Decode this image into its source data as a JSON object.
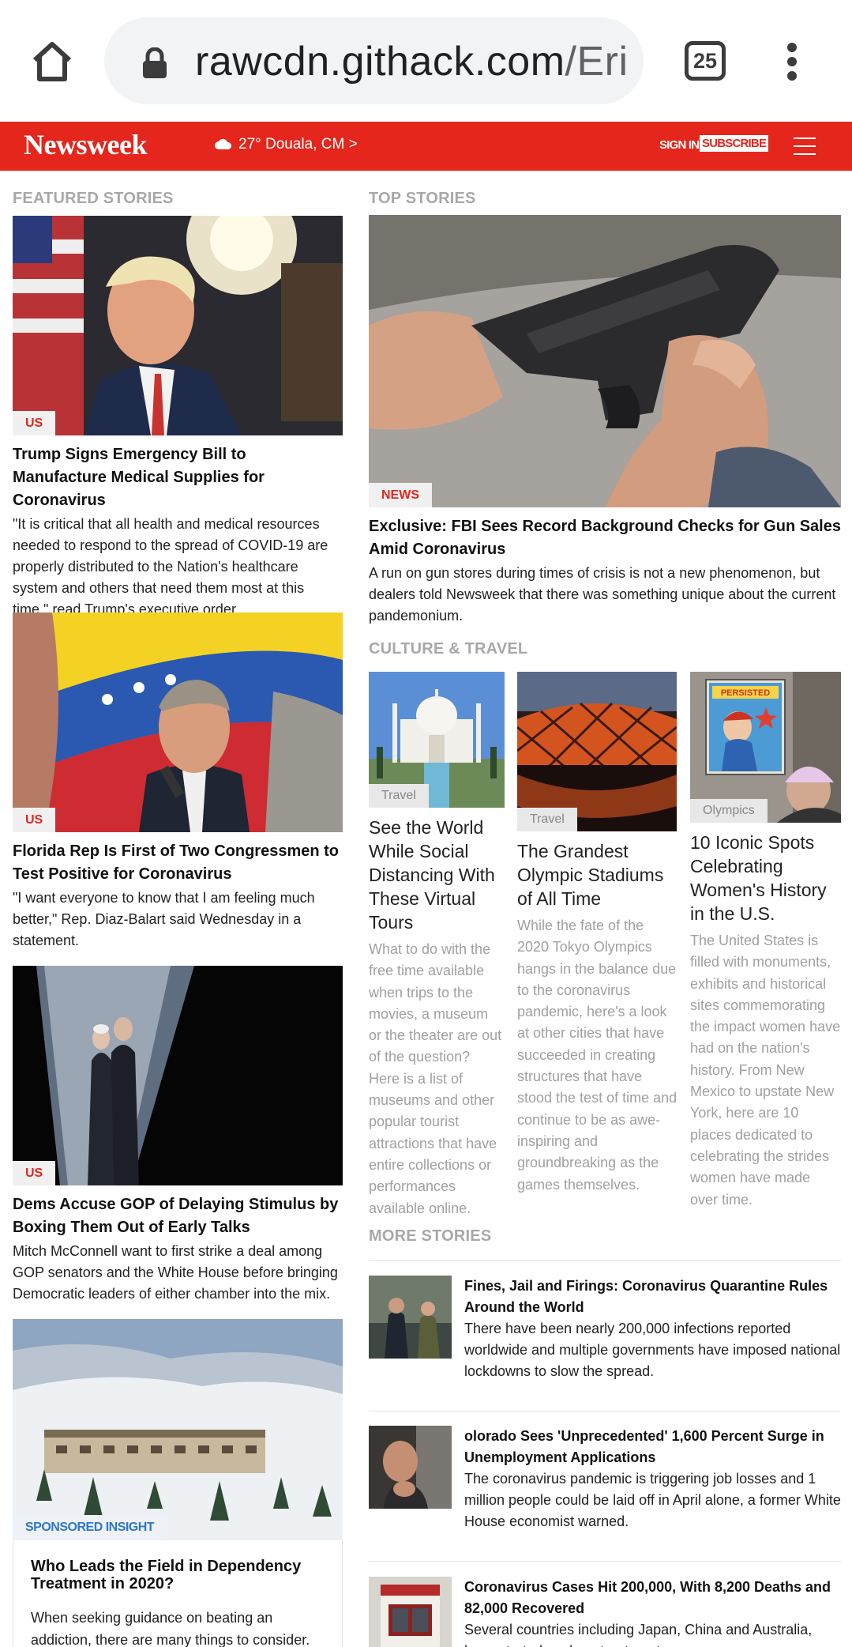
{
  "browser": {
    "url_host": "rawcdn.githack.com",
    "url_path": "/Eri",
    "tab_count": "25",
    "icons": {
      "home": "home-icon",
      "lock": "lock-icon",
      "menu": "more-vert-icon"
    }
  },
  "site": {
    "logo": "Newsweek",
    "weather": "27° Douala, CM >",
    "signin": "SIGN IN",
    "subscribe": "SUBSCRIBE",
    "brand_color": "#e4261c"
  },
  "featured": {
    "heading": "FEATURED STORIES",
    "items": [
      {
        "tag": "US",
        "title": "Trump Signs Emergency Bill to Manufacture Medical Supplies for Coronavirus",
        "summary": "\"It is critical that all health and medical resources needed to respond to the spread of COVID-19 are properly distributed to the Nation's healthcare system and others that need them most at this time,\" read Trump's executive order."
      },
      {
        "tag": "US",
        "title": "Florida Rep Is First of Two Congressmen to Test Positive for Coronavirus",
        "summary": "\"I want everyone to know that I am feeling much better,\" Rep. Diaz-Balart said Wednesday in a statement."
      },
      {
        "tag": "US",
        "title": "Dems Accuse GOP of Delaying Stimulus by Boxing Them Out of Early Talks",
        "summary": "Mitch McConnell want to first strike a deal among GOP senators and the White House before bringing Democratic leaders of either chamber into the mix."
      }
    ]
  },
  "sponsored": {
    "tag": "SPONSORED INSIGHT",
    "title": "Who Leads the Field in Dependency Treatment in 2020?",
    "summary": "When seeking guidance on beating an addiction, there are many things to consider."
  },
  "top": {
    "heading": "TOP STORIES",
    "tag": "NEWS",
    "title": "Exclusive: FBI Sees Record Background Checks for Gun Sales Amid Coronavirus",
    "summary": "A run on gun stores during times of crisis is not a new phenomenon, but dealers told Newsweek that there was something unique about the current pandemonium."
  },
  "culture": {
    "heading": "CULTURE & TRAVEL",
    "items": [
      {
        "tag": "Travel",
        "title": "See the World While Social Distancing With These Virtual Tours",
        "summary": "What to do with the free time available when trips to the movies, a museum or the theater are out of the question? Here is a list of museums and other popular tourist attractions that have entire collections or performances available online."
      },
      {
        "tag": "Travel",
        "title": "The Grandest Olympic Stadiums of All Time",
        "summary": "While the fate of the 2020 Tokyo Olympics hangs in the balance due to the coronavirus pandemic, here's a look at other cities that have succeeded in creating structures that have stood the test of time and continue to be as awe-inspiring and groundbreaking as the games themselves."
      },
      {
        "tag": "Olympics",
        "poster_text": "PERSISTED",
        "title": "10 Iconic Spots Celebrating Women's History in the U.S.",
        "summary": "The United States is filled with monuments, exhibits and historical sites commemorating the impact women have had on the nation's history. From New Mexico to upstate New York, here are 10 places dedicated to celebrating the strides women have made over time."
      }
    ]
  },
  "more": {
    "heading": "MORE STORIES",
    "items": [
      {
        "title": "Fines, Jail and Firings: Coronavirus Quarantine Rules Around the World",
        "summary": "There have been nearly 200,000 infections reported worldwide and multiple governments have imposed national lockdowns to slow the spread."
      },
      {
        "title": "olorado Sees 'Unprecedented' 1,600 Percent Surge in Unemployment Applications",
        "summary": "The coronavirus pandemic is triggering job losses and 1 million people could be laid off in April alone, a former White House economist warned."
      },
      {
        "title": "Coronavirus Cases Hit 200,000, With 8,200 Deaths and 82,000 Recovered",
        "summary": "Several countries including Japan, China and Australia, have started work on treatments."
      }
    ]
  }
}
